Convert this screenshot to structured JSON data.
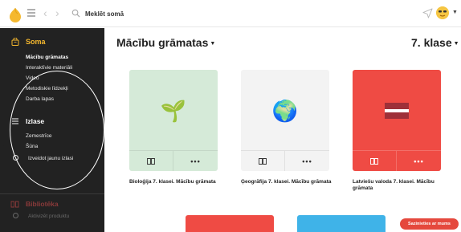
{
  "topbar": {
    "search_value": "Meklēt somā"
  },
  "sidebar": {
    "soma_title": "Soma",
    "soma_items": [
      {
        "label": "Mācību grāmatas"
      },
      {
        "label": "Interaktīvie materiāli"
      },
      {
        "label": "Video"
      },
      {
        "label": "Metodiskie līdzekļi"
      },
      {
        "label": "Darba lapas"
      }
    ],
    "izlase_title": "Izlase",
    "izlase_items": [
      {
        "label": "Zemestrīce"
      },
      {
        "label": "Šūna"
      }
    ],
    "create_selection": "Izveidot jaunu izlasi",
    "library_title": "Bibliotēka",
    "activate_product": "Aktivizēt produktu"
  },
  "main": {
    "title": "Mācību grāmatas",
    "grade": "7. klase",
    "cards": [
      {
        "caption": "Bioloģija 7. klasei. Mācību grāmata",
        "bg": "#d5ead8",
        "emoji": "🌱",
        "icon": "sprout-icon"
      },
      {
        "caption": "Ģeogrāfija 7. klasei. Mācību grāmata",
        "bg": "#f3f3f3",
        "emoji": "🌍",
        "icon": "globe-icon"
      },
      {
        "caption": "Latviešu valoda 7. klasei. Mācību grāmata",
        "bg": "#ef4b44",
        "emoji": "🇱🇻",
        "icon": "latvia-flag-icon"
      }
    ],
    "more_label": "•••",
    "bottom_cards": [
      {
        "bg": "#ef4b44"
      },
      {
        "bg": "#3fb3e8"
      }
    ]
  },
  "contact_button": "Sazinieties ar mums",
  "colors": {
    "sidebar_bg": "#222222",
    "accent_yellow": "#f5b82e",
    "contact_red": "#e5483d"
  }
}
